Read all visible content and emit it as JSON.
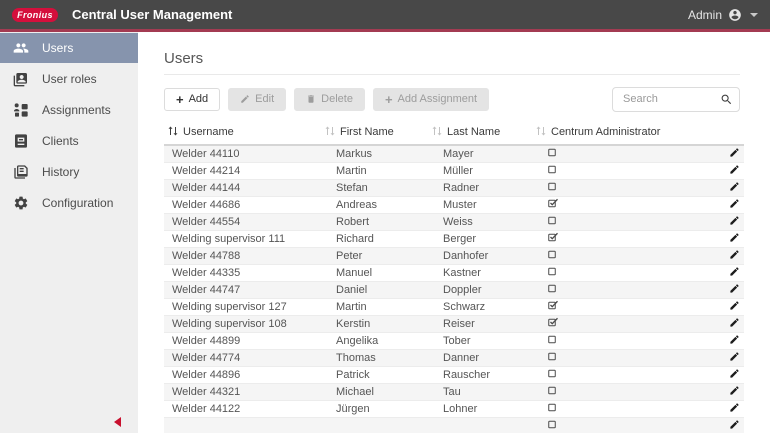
{
  "app": {
    "logo_text": "Fronius",
    "title": "Central User Management",
    "user_menu_label": "Admin",
    "colors": {
      "header_bg": "#484848",
      "accent_line": "#a33b52",
      "logo_red": "#d40f3c",
      "sidebar_bg": "#efefef",
      "sidebar_selected": "#8694ad",
      "collapse_arrow_red": "#c8102e",
      "row_alt": "#f5f5f5"
    }
  },
  "sidebar": {
    "items": [
      {
        "label": "Users",
        "selected": true
      },
      {
        "label": "User roles",
        "selected": false
      },
      {
        "label": "Assignments",
        "selected": false
      },
      {
        "label": "Clients",
        "selected": false
      },
      {
        "label": "History",
        "selected": false
      },
      {
        "label": "Configuration",
        "selected": false
      }
    ]
  },
  "main": {
    "page_title": "Users",
    "toolbar": {
      "add_label": "Add",
      "edit_label": "Edit",
      "delete_label": "Delete",
      "add_assignment_label": "Add Assignment",
      "search_placeholder": "Search",
      "search_value": ""
    },
    "users_table": {
      "columns": [
        {
          "label": "Username",
          "sorted": true
        },
        {
          "label": "First Name",
          "sorted": false
        },
        {
          "label": "Last Name",
          "sorted": false
        },
        {
          "label": "Centrum Administrator",
          "sorted": false
        }
      ],
      "rows": [
        {
          "username": "Welder 44110",
          "first_name": "Markus",
          "last_name": "Mayer",
          "centrum_administrator": false
        },
        {
          "username": "Welder 44214",
          "first_name": "Martin",
          "last_name": "Müller",
          "centrum_administrator": false
        },
        {
          "username": "Welder 44144",
          "first_name": "Stefan",
          "last_name": "Radner",
          "centrum_administrator": false
        },
        {
          "username": "Welder 44686",
          "first_name": "Andreas",
          "last_name": "Muster",
          "centrum_administrator": true
        },
        {
          "username": "Welder 44554",
          "first_name": "Robert",
          "last_name": "Weiss",
          "centrum_administrator": false
        },
        {
          "username": "Welding supervisor 111",
          "first_name": "Richard",
          "last_name": "Berger",
          "centrum_administrator": true
        },
        {
          "username": "Welder 44788",
          "first_name": "Peter",
          "last_name": "Danhofer",
          "centrum_administrator": false
        },
        {
          "username": "Welder 44335",
          "first_name": "Manuel",
          "last_name": "Kastner",
          "centrum_administrator": false
        },
        {
          "username": "Welder 44747",
          "first_name": "Daniel",
          "last_name": "Doppler",
          "centrum_administrator": false
        },
        {
          "username": "Welding supervisor 127",
          "first_name": "Martin",
          "last_name": "Schwarz",
          "centrum_administrator": true
        },
        {
          "username": "Welding supervisor 108",
          "first_name": "Kerstin",
          "last_name": "Reiser",
          "centrum_administrator": true
        },
        {
          "username": "Welder 44899",
          "first_name": "Angelika",
          "last_name": "Tober",
          "centrum_administrator": false
        },
        {
          "username": "Welder 44774",
          "first_name": "Thomas",
          "last_name": "Danner",
          "centrum_administrator": false
        },
        {
          "username": "Welder 44896",
          "first_name": "Patrick",
          "last_name": "Rauscher",
          "centrum_administrator": false
        },
        {
          "username": "Welder 44321",
          "first_name": "Michael",
          "last_name": "Tau",
          "centrum_administrator": false
        },
        {
          "username": "Welder 44122",
          "first_name": "Jürgen",
          "last_name": "Lohner",
          "centrum_administrator": false
        },
        {
          "username": "",
          "first_name": "",
          "last_name": "",
          "centrum_administrator": false,
          "partially_visible": true
        }
      ]
    }
  }
}
